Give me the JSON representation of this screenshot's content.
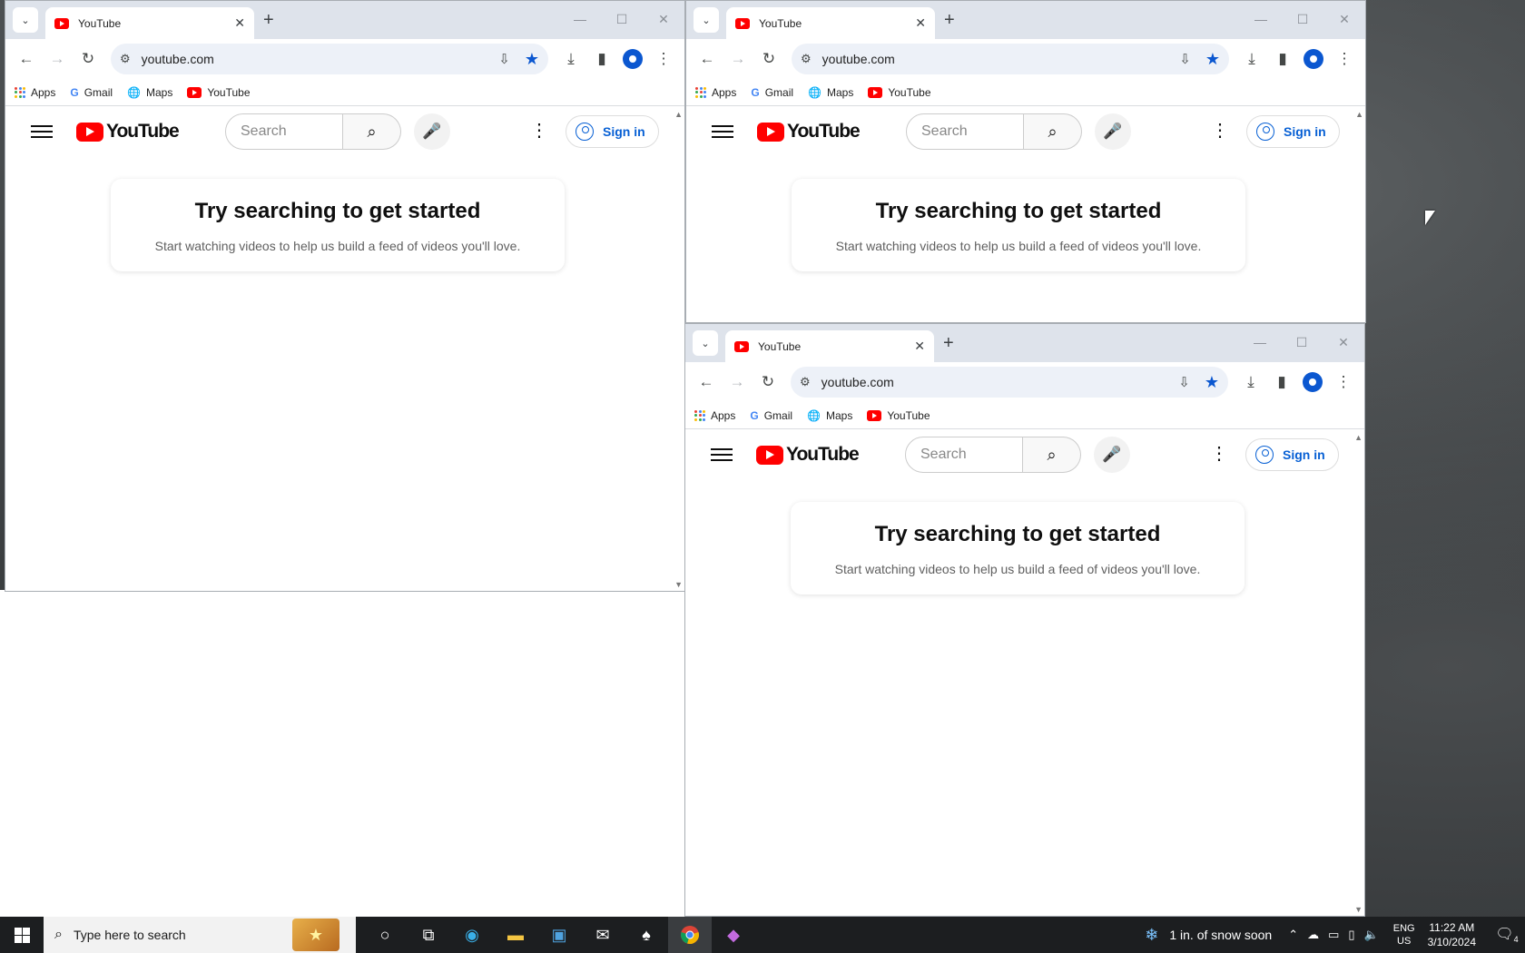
{
  "tab": {
    "title": "YouTube",
    "close": "✕",
    "new": "+"
  },
  "window_controls": {
    "minimize": "—",
    "maximize": "☐",
    "close": "✕"
  },
  "toolbar": {
    "back": "←",
    "forward": "→",
    "reload": "↻",
    "url": "youtube.com"
  },
  "bookmarks": {
    "apps": "Apps",
    "gmail": "Gmail",
    "maps": "Maps",
    "youtube": "YouTube"
  },
  "youtube": {
    "logo_text": "YouTube",
    "search_placeholder": "Search",
    "sign_in": "Sign in",
    "card_title": "Try searching to get started",
    "card_text": "Start watching videos to help us build a feed of videos you'll love."
  },
  "taskbar": {
    "search_placeholder": "Type here to search",
    "weather": "1 in. of snow soon",
    "lang_top": "ENG",
    "lang_bottom": "US",
    "time": "11:22 AM",
    "date": "3/10/2024",
    "notif_count": "4"
  },
  "colors": {
    "accent": "#0b57d0",
    "youtube_red": "#ff0000",
    "taskbar": "#1c1e20"
  }
}
